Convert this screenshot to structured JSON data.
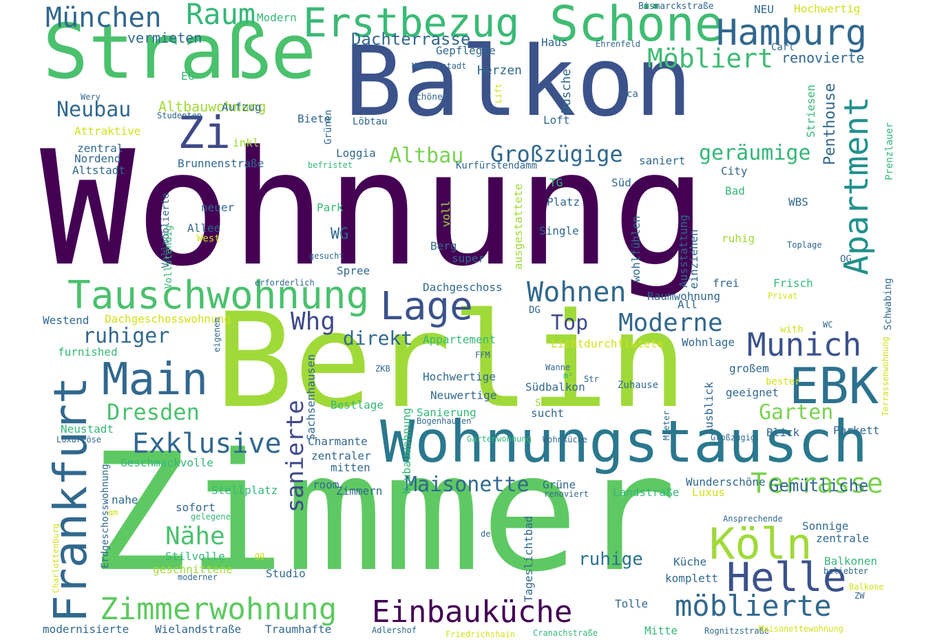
{
  "title": "",
  "colormap": "viridis",
  "background": "#ffffff",
  "orientation_note": "some words drawn rotated 90 degrees (vertical)",
  "words": [
    {
      "t": "Wohnung",
      "c": "#440154",
      "v": false
    },
    {
      "t": "Zimmer",
      "c": "#5ec962",
      "v": false
    },
    {
      "t": "Berlin",
      "c": "#a0da39",
      "v": false
    },
    {
      "t": "Balkon",
      "c": "#3b528b",
      "v": false
    },
    {
      "t": "Straße",
      "c": "#4ac16d",
      "v": false
    },
    {
      "t": "Wohnungstausch",
      "c": "#2a788e",
      "v": false
    },
    {
      "t": "Frankfurt",
      "c": "#31688e",
      "v": true
    },
    {
      "t": "Schöne",
      "c": "#3fbc73",
      "v": false
    },
    {
      "t": "Erstbezug",
      "c": "#3aba76",
      "v": false
    },
    {
      "t": "Hamburg",
      "c": "#31688e",
      "v": false
    },
    {
      "t": "Tauschwohnung",
      "c": "#4ac16d",
      "v": false
    },
    {
      "t": "Lage",
      "c": "#3b528b",
      "v": false
    },
    {
      "t": "Main",
      "c": "#31688e",
      "v": false
    },
    {
      "t": "EBK",
      "c": "#2c728e",
      "v": false
    },
    {
      "t": "Köln",
      "c": "#a0da39",
      "v": false
    },
    {
      "t": "Helle",
      "c": "#3b528b",
      "v": false
    },
    {
      "t": "Einbauküche",
      "c": "#440154",
      "v": false
    },
    {
      "t": "Zimmerwohnung",
      "c": "#5ec962",
      "v": false
    },
    {
      "t": "möblierte",
      "c": "#31688e",
      "v": false
    },
    {
      "t": "Munich",
      "c": "#3b528b",
      "v": false
    },
    {
      "t": "Terrasse",
      "c": "#7ad151",
      "v": false
    },
    {
      "t": "Apartment",
      "c": "#21918c",
      "v": true
    },
    {
      "t": "Zi",
      "c": "#3e4a89",
      "v": false
    },
    {
      "t": "München",
      "c": "#31688e",
      "v": false
    },
    {
      "t": "Raum",
      "c": "#35b779",
      "v": false
    },
    {
      "t": "Möbliert",
      "c": "#3fbc73",
      "v": false
    },
    {
      "t": "Neubau",
      "c": "#31688e",
      "v": false
    },
    {
      "t": "Wohnen",
      "c": "#31688e",
      "v": false
    },
    {
      "t": "Moderne",
      "c": "#31688e",
      "v": false
    },
    {
      "t": "Top",
      "c": "#3e4a89",
      "v": false
    },
    {
      "t": "Whg",
      "c": "#3e4a89",
      "v": false
    },
    {
      "t": "Exklusive",
      "c": "#31688e",
      "v": false
    },
    {
      "t": "Dresden",
      "c": "#4ac16d",
      "v": false
    },
    {
      "t": "Nähe",
      "c": "#4ac16d",
      "v": false
    },
    {
      "t": "sanierte",
      "c": "#3e4a89",
      "v": true
    },
    {
      "t": "Großzügige",
      "c": "#31688e",
      "v": false
    },
    {
      "t": "geräumige",
      "c": "#35b779",
      "v": false
    },
    {
      "t": "Altbau",
      "c": "#7ad151",
      "v": false
    },
    {
      "t": "ruhiger",
      "c": "#31688e",
      "v": false
    },
    {
      "t": "direkt",
      "c": "#31688e",
      "v": false
    },
    {
      "t": "Maisonette",
      "c": "#31688e",
      "v": false
    },
    {
      "t": "Garten",
      "c": "#7ad151",
      "v": false
    },
    {
      "t": "Gemütliche",
      "c": "#31688e",
      "v": false
    },
    {
      "t": "ruhige",
      "c": "#2c728e",
      "v": false
    },
    {
      "t": "Dachterrasse",
      "c": "#31688e",
      "v": false
    },
    {
      "t": "vermieten",
      "c": "#31688e",
      "v": false
    },
    {
      "t": "renovierte",
      "c": "#31688e",
      "v": false
    },
    {
      "t": "Penthouse",
      "c": "#31688e",
      "v": true
    },
    {
      "t": "Altbauwohnung",
      "c": "#a0da39",
      "v": false
    },
    {
      "t": "Dusche",
      "c": "#31688e",
      "v": true
    },
    {
      "t": "Herzen",
      "c": "#31688e",
      "v": false
    },
    {
      "t": "Haus",
      "c": "#31688e",
      "v": false
    },
    {
      "t": "Modern",
      "c": "#35b779",
      "v": false
    },
    {
      "t": "NEU",
      "c": "#31688e",
      "v": false
    },
    {
      "t": "Hochwertig",
      "c": "#d0e11c",
      "v": false
    },
    {
      "t": "Bismarckstraße",
      "c": "#31688e",
      "v": false
    },
    {
      "t": "Gepflegte",
      "c": "#31688e",
      "v": false
    },
    {
      "t": "Maxvorstadt",
      "c": "#31688e",
      "v": false
    },
    {
      "t": "Ehrenfeld",
      "c": "#31688e",
      "v": false
    },
    {
      "t": "Carl",
      "c": "#31688e",
      "v": false
    },
    {
      "t": "EG",
      "c": "#35b779",
      "v": false
    },
    {
      "t": "Wery",
      "c": "#31688e",
      "v": false
    },
    {
      "t": "schöner",
      "c": "#31688e",
      "v": false
    },
    {
      "t": "Lift",
      "c": "#d0e11c",
      "v": true
    },
    {
      "t": "ca",
      "c": "#31688e",
      "v": false
    },
    {
      "t": "Striesen",
      "c": "#35b779",
      "v": true
    },
    {
      "t": "Studenten",
      "c": "#31688e",
      "v": false
    },
    {
      "t": "Aufzug",
      "c": "#31688e",
      "v": false
    },
    {
      "t": "Biete",
      "c": "#31688e",
      "v": false
    },
    {
      "t": "Grünen",
      "c": "#31688e",
      "v": true
    },
    {
      "t": "Löbtau",
      "c": "#31688e",
      "v": false
    },
    {
      "t": "Loft",
      "c": "#31688e",
      "v": false
    },
    {
      "t": "Attraktive",
      "c": "#d0e11c",
      "v": false
    },
    {
      "t": "inkl",
      "c": "#a0da39",
      "v": false
    },
    {
      "t": "zentral",
      "c": "#31688e",
      "v": false
    },
    {
      "t": "Nordend",
      "c": "#31688e",
      "v": false
    },
    {
      "t": "Altstadt",
      "c": "#31688e",
      "v": false
    },
    {
      "t": "Loggia",
      "c": "#31688e",
      "v": false
    },
    {
      "t": "befristet",
      "c": "#35b779",
      "v": false
    },
    {
      "t": "Kurfürstendamm",
      "c": "#31688e",
      "v": false
    },
    {
      "t": "saniert",
      "c": "#31688e",
      "v": false
    },
    {
      "t": "City",
      "c": "#31688e",
      "v": false
    },
    {
      "t": "Prenzlauer",
      "c": "#35b779",
      "v": true
    },
    {
      "t": "Brunnenstraße",
      "c": "#31688e",
      "v": false
    },
    {
      "t": "TG",
      "c": "#35b779",
      "v": false
    },
    {
      "t": "Süd",
      "c": "#31688e",
      "v": false
    },
    {
      "t": "Bad",
      "c": "#35b779",
      "v": false
    },
    {
      "t": "Platz",
      "c": "#31688e",
      "v": false
    },
    {
      "t": "WBS",
      "c": "#31688e",
      "v": false
    },
    {
      "t": "neuer",
      "c": "#31688e",
      "v": false
    },
    {
      "t": "Park",
      "c": "#35b779",
      "v": false
    },
    {
      "t": "Allee",
      "c": "#31688e",
      "v": false
    },
    {
      "t": "West",
      "c": "#d0e11c",
      "v": false
    },
    {
      "t": "WG",
      "c": "#31688e",
      "v": false
    },
    {
      "t": "Single",
      "c": "#31688e",
      "v": false
    },
    {
      "t": "ruhig",
      "c": "#a0da39",
      "v": false
    },
    {
      "t": "Toplage",
      "c": "#31688e",
      "v": false
    },
    {
      "t": "Vollmöblierte",
      "c": "#31688e",
      "v": true
    },
    {
      "t": "Vollständig",
      "c": "#35b779",
      "v": true
    },
    {
      "t": "Berg",
      "c": "#31688e",
      "v": false
    },
    {
      "t": "super",
      "c": "#31688e",
      "v": false
    },
    {
      "t": "gesucht",
      "c": "#31688e",
      "v": false
    },
    {
      "t": "Spree",
      "c": "#31688e",
      "v": false
    },
    {
      "t": "OG",
      "c": "#31688e",
      "v": false
    },
    {
      "t": "erforderlich",
      "c": "#31688e",
      "v": false
    },
    {
      "t": "Dachgeschoss",
      "c": "#31688e",
      "v": false
    },
    {
      "t": "frei",
      "c": "#31688e",
      "v": false
    },
    {
      "t": "Frisch",
      "c": "#35b779",
      "v": false
    },
    {
      "t": "Privat",
      "c": "#d0e11c",
      "v": false
    },
    {
      "t": "Raumwohnung",
      "c": "#31688e",
      "v": false
    },
    {
      "t": "All",
      "c": "#31688e",
      "v": false
    },
    {
      "t": "Schwabing",
      "c": "#31688e",
      "v": true
    },
    {
      "t": "Westend",
      "c": "#31688e",
      "v": false
    },
    {
      "t": "Dachgeschosswohnung",
      "c": "#d0e11c",
      "v": false
    },
    {
      "t": "DG",
      "c": "#31688e",
      "v": false
    },
    {
      "t": "with",
      "c": "#d0e11c",
      "v": false
    },
    {
      "t": "WC",
      "c": "#31688e",
      "v": false
    },
    {
      "t": "Appartement",
      "c": "#35b779",
      "v": false
    },
    {
      "t": "Lichtdurchflutete",
      "c": "#d0e11c",
      "v": false
    },
    {
      "t": "Wohnlage",
      "c": "#31688e",
      "v": false
    },
    {
      "t": "furnished",
      "c": "#35b779",
      "v": false
    },
    {
      "t": "FFM",
      "c": "#31688e",
      "v": false
    },
    {
      "t": "Wanne",
      "c": "#31688e",
      "v": false
    },
    {
      "t": "großem",
      "c": "#31688e",
      "v": false
    },
    {
      "t": "bester",
      "c": "#d0e11c",
      "v": false
    },
    {
      "t": "geeignet",
      "c": "#31688e",
      "v": false
    },
    {
      "t": "ZKB",
      "c": "#31688e",
      "v": false
    },
    {
      "t": "Hochwertige",
      "c": "#31688e",
      "v": false
    },
    {
      "t": "m²",
      "c": "#35b779",
      "v": false
    },
    {
      "t": "Str",
      "c": "#31688e",
      "v": false
    },
    {
      "t": "Zuhause",
      "c": "#31688e",
      "v": false
    },
    {
      "t": "Südbalkon",
      "c": "#31688e",
      "v": false
    },
    {
      "t": "Neuwertige",
      "c": "#31688e",
      "v": false
    },
    {
      "t": "Schicke",
      "c": "#a0da39",
      "v": false
    },
    {
      "t": "Bestlage",
      "c": "#35b779",
      "v": false
    },
    {
      "t": "sucht",
      "c": "#31688e",
      "v": false
    },
    {
      "t": "Sanierung",
      "c": "#35b779",
      "v": false
    },
    {
      "t": "Bogenhausen",
      "c": "#31688e",
      "v": false
    },
    {
      "t": "Neustadt",
      "c": "#35b779",
      "v": false
    },
    {
      "t": "Luxuriöse",
      "c": "#31688e",
      "v": false
    },
    {
      "t": "Charmante",
      "c": "#31688e",
      "v": false
    },
    {
      "t": "Gartenwohnung",
      "c": "#35b779",
      "v": false
    },
    {
      "t": "Wohnküche",
      "c": "#31688e",
      "v": false
    },
    {
      "t": "Blick",
      "c": "#31688e",
      "v": false
    },
    {
      "t": "Parkett",
      "c": "#31688e",
      "v": false
    },
    {
      "t": "Großzügig",
      "c": "#31688e",
      "v": false
    },
    {
      "t": "zentraler",
      "c": "#31688e",
      "v": false
    },
    {
      "t": "mitten",
      "c": "#31688e",
      "v": false
    },
    {
      "t": "Geschmackvolle",
      "c": "#35b779",
      "v": false
    },
    {
      "t": "Wunderschöne",
      "c": "#31688e",
      "v": false
    },
    {
      "t": "Stellplatz",
      "c": "#35b779",
      "v": false
    },
    {
      "t": "room",
      "c": "#31688e",
      "v": false
    },
    {
      "t": "Zimmern",
      "c": "#31688e",
      "v": false
    },
    {
      "t": "Grüne",
      "c": "#31688e",
      "v": false
    },
    {
      "t": "renoviert",
      "c": "#31688e",
      "v": false
    },
    {
      "t": "Landstraße",
      "c": "#35b779",
      "v": false
    },
    {
      "t": "Luxus",
      "c": "#d0e11c",
      "v": false
    },
    {
      "t": "nahe",
      "c": "#31688e",
      "v": false
    },
    {
      "t": "sofort",
      "c": "#31688e",
      "v": false
    },
    {
      "t": "qm",
      "c": "#d0e11c",
      "v": false
    },
    {
      "t": "gelegene",
      "c": "#35b779",
      "v": false
    },
    {
      "t": "Ansprechende",
      "c": "#31688e",
      "v": false
    },
    {
      "t": "Sonnige",
      "c": "#31688e",
      "v": false
    },
    {
      "t": "zentrale",
      "c": "#31688e",
      "v": false
    },
    {
      "t": "de",
      "c": "#31688e",
      "v": false
    },
    {
      "t": "Stilvolle",
      "c": "#35b779",
      "v": false
    },
    {
      "t": "gg",
      "c": "#d0e11c",
      "v": false
    },
    {
      "t": "geschnittene",
      "c": "#a0da39",
      "v": false
    },
    {
      "t": "moderner",
      "c": "#31688e",
      "v": false
    },
    {
      "t": "Studio",
      "c": "#31688e",
      "v": false
    },
    {
      "t": "Küche",
      "c": "#31688e",
      "v": false
    },
    {
      "t": "komplett",
      "c": "#31688e",
      "v": false
    },
    {
      "t": "Balkonen",
      "c": "#35b779",
      "v": false
    },
    {
      "t": "beliebter",
      "c": "#31688e",
      "v": false
    },
    {
      "t": "Balkone",
      "c": "#d0e11c",
      "v": false
    },
    {
      "t": "ZW",
      "c": "#31688e",
      "v": false
    },
    {
      "t": "Tolle",
      "c": "#31688e",
      "v": false
    },
    {
      "t": "Mitte",
      "c": "#35b779",
      "v": false
    },
    {
      "t": "modernisierte",
      "c": "#31688e",
      "v": false
    },
    {
      "t": "Wielandstraße",
      "c": "#31688e",
      "v": false
    },
    {
      "t": "Traumhafte",
      "c": "#31688e",
      "v": false
    },
    {
      "t": "Adlershof",
      "c": "#31688e",
      "v": false
    },
    {
      "t": "Friedrichshain",
      "c": "#d0e11c",
      "v": false
    },
    {
      "t": "Cranachstraße",
      "c": "#35b779",
      "v": false
    },
    {
      "t": "Rognitzstraße",
      "c": "#31688e",
      "v": false
    },
    {
      "t": "Maisonettewohnung",
      "c": "#d0e11c",
      "v": false
    },
    {
      "t": "Charlottenburg",
      "c": "#d0e11c",
      "v": true
    },
    {
      "t": "Erdgeschosswohnung",
      "c": "#31688e",
      "v": true
    },
    {
      "t": "Sachsenhausen",
      "c": "#31688e",
      "v": true
    },
    {
      "t": "Neubauwohnung",
      "c": "#35b779",
      "v": true
    },
    {
      "t": "ausgestattete",
      "c": "#a0da39",
      "v": true
    },
    {
      "t": "voll",
      "c": "#a0da39",
      "v": true
    },
    {
      "t": "wohlfühlen",
      "c": "#31688e",
      "v": true
    },
    {
      "t": "Ausstattung",
      "c": "#31688e",
      "v": true
    },
    {
      "t": "einziehen",
      "c": "#31688e",
      "v": true
    },
    {
      "t": "Ausblick",
      "c": "#31688e",
      "v": true
    },
    {
      "t": "Mieter",
      "c": "#31688e",
      "v": true
    },
    {
      "t": "eigenem",
      "c": "#31688e",
      "v": true
    },
    {
      "t": "Tageslichtbad",
      "c": "#31688e",
      "v": true
    },
    {
      "t": "Terrassenwohnung",
      "c": "#d0e11c",
      "v": true
    }
  ]
}
